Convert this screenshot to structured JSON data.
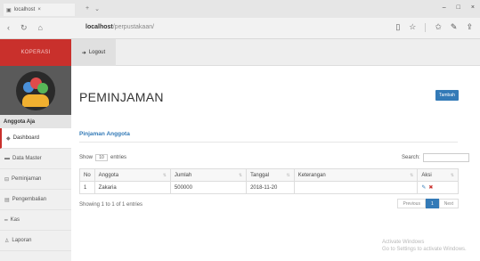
{
  "browser": {
    "tab_title": "localhost",
    "url_host": "localhost",
    "url_path": "/perpustakaan/",
    "window_controls": [
      "–",
      "□",
      "×"
    ]
  },
  "sidebar": {
    "brand": "KOPERASI",
    "user_label": "Anggota Aja",
    "items": [
      {
        "icon": "dashboard-icon",
        "label": "Dashboard",
        "active": true
      },
      {
        "icon": "data-icon",
        "label": "Data Master",
        "active": false
      },
      {
        "icon": "loan-icon",
        "label": "Peminjaman",
        "active": false
      },
      {
        "icon": "return-icon",
        "label": "Pengembalian",
        "active": false
      },
      {
        "icon": "list-icon",
        "label": "Kas",
        "active": false
      },
      {
        "icon": "user-icon",
        "label": "Laporan",
        "active": false
      }
    ]
  },
  "topbar": {
    "logout_label": "Logout"
  },
  "main": {
    "title": "PEMINJAMAN",
    "add_button": "Tambah",
    "panel_title": "Pinjaman Anggota",
    "show_prefix": "Show",
    "show_value": "10",
    "show_suffix": "entries",
    "search_label": "Search:",
    "search_value": "",
    "columns": [
      "No",
      "Anggota",
      "Jumlah",
      "Tanggal",
      "Keterangan",
      "Aksi"
    ],
    "rows": [
      {
        "no": "1",
        "anggota": "Zakaria",
        "jumlah": "500000",
        "tanggal": "2018-11-20",
        "keterangan": ""
      }
    ],
    "info": "Showing 1 to 1 of 1 entries",
    "pager": {
      "prev": "Previous",
      "current": "1",
      "next": "Next"
    }
  },
  "watermark": {
    "line1": "Activate Windows",
    "line2": "Go to Settings to activate Windows."
  },
  "colors": {
    "brand_red": "#c9302c",
    "primary_blue": "#337ab7"
  }
}
